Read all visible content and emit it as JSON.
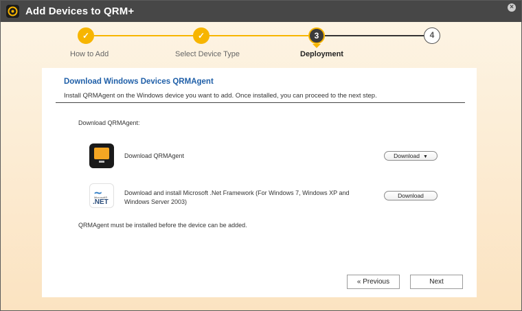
{
  "window": {
    "title": "Add Devices to QRM+",
    "close_glyph": "×"
  },
  "stepper": {
    "steps": [
      {
        "label": "How to Add",
        "state": "done",
        "marker": "✓"
      },
      {
        "label": "Select Device Type",
        "state": "done",
        "marker": "✓"
      },
      {
        "label": "Deployment",
        "state": "active",
        "marker": "3"
      },
      {
        "label": "",
        "state": "todo",
        "marker": "4"
      }
    ],
    "colors": {
      "accent": "#f7b500",
      "active_bg": "#3b3b3b",
      "line_done": "#f7b500",
      "line_todo": "#333333"
    }
  },
  "content": {
    "title": "Download Windows Devices QRMAgent",
    "description": "Install QRMAgent on the Windows device you want to add. Once installed, you can proceed to the next step.",
    "section_label": "Download QRMAgent:",
    "items": [
      {
        "icon": "qrmagent-icon",
        "text": "Download QRMAgent",
        "button_label": "Download",
        "has_dropdown": true
      },
      {
        "icon": "dotnet-icon",
        "text": "Download and install Microsoft .Net Framework (For Windows 7, Windows XP and Windows Server 2003)",
        "button_label": "Download",
        "has_dropdown": false
      }
    ],
    "note": "QRMAgent must be installed before the device can be added.",
    "net_icon": {
      "small": "Microsoft®",
      "big": ".NET"
    }
  },
  "footer": {
    "previous_label": "« Previous",
    "next_label": "Next"
  },
  "colors": {
    "titlebar": "#474747",
    "title_link": "#1f5fa8"
  }
}
